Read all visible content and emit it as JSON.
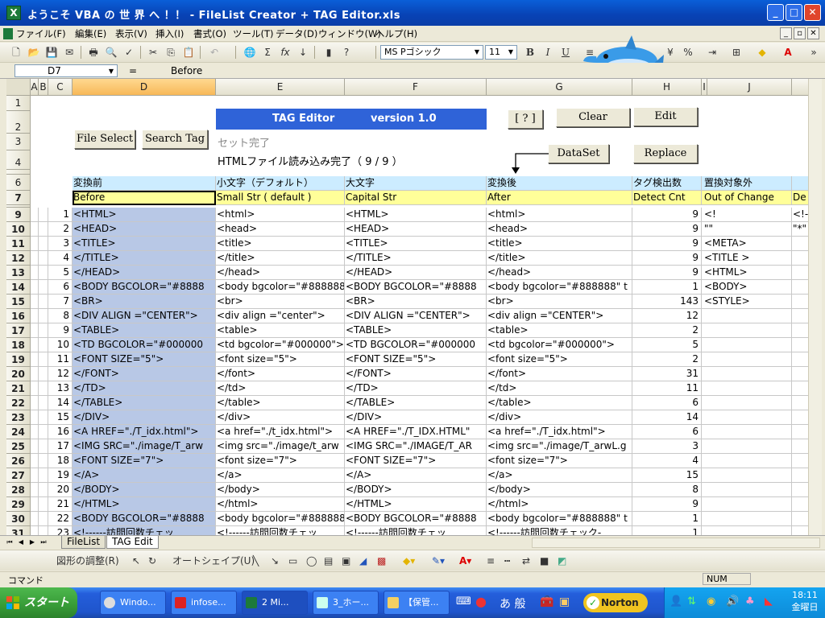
{
  "window": {
    "title": "ようこそ VBA の 世 界 へ ！！ - FileList Creator + TAG Editor.xls",
    "minimize": "_",
    "maximize": "□",
    "close": "✕"
  },
  "menu": [
    "ファイル(F)",
    "編集(E)",
    "表示(V)",
    "挿入(I)",
    "書式(O)",
    "ツール(T)",
    "データ(D)",
    "ウィンドウ(W)",
    "ヘルプ(H)"
  ],
  "toolbar": {
    "font_name": "MS Pゴシック",
    "font_size": "11",
    "bold": "B",
    "italic": "I",
    "underline": "U"
  },
  "formula_bar": {
    "cell_ref": "D7",
    "eq": "=",
    "content": "Before"
  },
  "columns": [
    "A",
    "B",
    "C",
    "D",
    "E",
    "F",
    "G",
    "H",
    "I",
    "J",
    ""
  ],
  "sheet": {
    "banner": {
      "title": "TAG Editor",
      "version": "version 1.0"
    },
    "buttons": {
      "help": "[ ? ]",
      "clear": "Clear",
      "edit": "Edit",
      "file_select": "File Select",
      "search_tag": "Search Tag",
      "dataset": "DataSet",
      "replace": "Replace"
    },
    "status1": "セット完了",
    "status2": "HTMLファイル読み込み完了（ 9 / 9 ）",
    "header_jp": [
      "変換前",
      "小文字（デフォルト）",
      "大文字",
      "変換後",
      "タグ検出数",
      "置換対象外"
    ],
    "header_en": [
      "Before",
      "Small Str ( default )",
      "Capital Str",
      "After",
      "Detect Cnt",
      "Out of Change",
      "De"
    ],
    "top_rows": [
      "1",
      "2",
      "3",
      "4",
      "6",
      "7"
    ],
    "rows": [
      {
        "r": "9",
        "n": "1",
        "before": "<HTML>",
        "small": "<html>",
        "cap": "<HTML>",
        "after": "<html>",
        "cnt": "9",
        "out": "<!",
        "k": "<!--"
      },
      {
        "r": "10",
        "n": "2",
        "before": "<HEAD>",
        "small": "<head>",
        "cap": "<HEAD>",
        "after": "<head>",
        "cnt": "9",
        "out": "\"\"",
        "k": "\"*\""
      },
      {
        "r": "11",
        "n": "3",
        "before": "<TITLE>",
        "small": "<title>",
        "cap": "<TITLE>",
        "after": "<title>",
        "cnt": "9",
        "out": "<META>",
        "k": ""
      },
      {
        "r": "12",
        "n": "4",
        "before": "</TITLE>",
        "small": "</title>",
        "cap": "</TITLE>",
        "after": "</title>",
        "cnt": "9",
        "out": "<TITLE >",
        "k": ""
      },
      {
        "r": "13",
        "n": "5",
        "before": "</HEAD>",
        "small": "</head>",
        "cap": "</HEAD>",
        "after": "</head>",
        "cnt": "9",
        "out": "<HTML>",
        "k": ""
      },
      {
        "r": "14",
        "n": "6",
        "before": "<BODY BGCOLOR=\"#8888",
        "small": "<body bgcolor=\"#888888",
        "cap": "<BODY BGCOLOR=\"#8888",
        "after": "<body bgcolor=\"#888888\" t",
        "cnt": "1",
        "out": "<BODY>",
        "k": ""
      },
      {
        "r": "15",
        "n": "7",
        "before": "<BR>",
        "small": "<br>",
        "cap": "<BR>",
        "after": "<br>",
        "cnt": "143",
        "out": "<STYLE>",
        "k": ""
      },
      {
        "r": "16",
        "n": "8",
        "before": "<DIV ALIGN =\"CENTER\">",
        "small": "<div align =\"center\">",
        "cap": "<DIV ALIGN =\"CENTER\">",
        "after": "<div align =\"CENTER\">",
        "cnt": "12",
        "out": "",
        "k": ""
      },
      {
        "r": "17",
        "n": "9",
        "before": "<TABLE>",
        "small": "<table>",
        "cap": "<TABLE>",
        "after": "<table>",
        "cnt": "2",
        "out": "",
        "k": ""
      },
      {
        "r": "18",
        "n": "10",
        "before": "<TD BGCOLOR=\"#000000",
        "small": "<td bgcolor=\"#000000\">",
        "cap": "<TD BGCOLOR=\"#000000",
        "after": "<td bgcolor=\"#000000\">",
        "cnt": "5",
        "out": "",
        "k": ""
      },
      {
        "r": "19",
        "n": "11",
        "before": "<FONT SIZE=\"5\">",
        "small": "<font size=\"5\">",
        "cap": "<FONT SIZE=\"5\">",
        "after": "<font size=\"5\">",
        "cnt": "2",
        "out": "",
        "k": ""
      },
      {
        "r": "20",
        "n": "12",
        "before": "</FONT>",
        "small": "</font>",
        "cap": "</FONT>",
        "after": "</font>",
        "cnt": "31",
        "out": "",
        "k": ""
      },
      {
        "r": "21",
        "n": "13",
        "before": "</TD>",
        "small": "</td>",
        "cap": "</TD>",
        "after": "</td>",
        "cnt": "11",
        "out": "",
        "k": ""
      },
      {
        "r": "22",
        "n": "14",
        "before": "</TABLE>",
        "small": "</table>",
        "cap": "</TABLE>",
        "after": "</table>",
        "cnt": "6",
        "out": "",
        "k": ""
      },
      {
        "r": "23",
        "n": "15",
        "before": "</DIV>",
        "small": "</div>",
        "cap": "</DIV>",
        "after": "</div>",
        "cnt": "14",
        "out": "",
        "k": ""
      },
      {
        "r": "24",
        "n": "16",
        "before": "<A HREF=\"./T_idx.html\">",
        "small": "<a href=\"./t_idx.html\">",
        "cap": "<A HREF=\"./T_IDX.HTML\"",
        "after": "<a href=\"./T_idx.html\">",
        "cnt": "6",
        "out": "",
        "k": ""
      },
      {
        "r": "25",
        "n": "17",
        "before": "<IMG SRC=\"./image/T_arw",
        "small": "<img src=\"./image/t_arw",
        "cap": "<IMG SRC=\"./IMAGE/T_AR",
        "after": "<img src=\"./image/T_arwL.g",
        "cnt": "3",
        "out": "",
        "k": ""
      },
      {
        "r": "26",
        "n": "18",
        "before": "<FONT SIZE=\"7\">",
        "small": "<font size=\"7\">",
        "cap": "<FONT SIZE=\"7\">",
        "after": "<font size=\"7\">",
        "cnt": "4",
        "out": "",
        "k": ""
      },
      {
        "r": "27",
        "n": "19",
        "before": "</A>",
        "small": "</a>",
        "cap": "</A>",
        "after": "</a>",
        "cnt": "15",
        "out": "",
        "k": ""
      },
      {
        "r": "28",
        "n": "20",
        "before": "</BODY>",
        "small": "</body>",
        "cap": "</BODY>",
        "after": "</body>",
        "cnt": "8",
        "out": "",
        "k": ""
      },
      {
        "r": "29",
        "n": "21",
        "before": "</HTML>",
        "small": "</html>",
        "cap": "</HTML>",
        "after": "</html>",
        "cnt": "9",
        "out": "",
        "k": ""
      },
      {
        "r": "30",
        "n": "22",
        "before": "<BODY BGCOLOR=\"#8888",
        "small": "<body bgcolor=\"#888888",
        "cap": "<BODY BGCOLOR=\"#8888",
        "after": "<body bgcolor=\"#888888\" t",
        "cnt": "1",
        "out": "",
        "k": ""
      },
      {
        "r": "31",
        "n": "23",
        "before": "<!------訪問回数チェッ",
        "small": "<!------訪問回数チェッ",
        "cap": "<!------訪問回数チェッ",
        "after": "<!------訪問回数チェック-",
        "cnt": "1",
        "out": "",
        "k": ""
      }
    ]
  },
  "tabs": {
    "tab1": "FileList",
    "tab2": "TAG Edit"
  },
  "drawbar": {
    "adjust": "図形の調整(R)",
    "autoshape": "オートシェイプ(U)"
  },
  "status": {
    "mode": "コマンド",
    "num": "NUM"
  },
  "taskbar": {
    "start": "スタート",
    "tasks": [
      "Windo...",
      "infose...",
      "2 Mi...",
      "3_ホー...",
      "【保管..."
    ],
    "tray_icons": "あ 般",
    "norton": "Norton",
    "time": "18:11",
    "day": "金曜日"
  }
}
